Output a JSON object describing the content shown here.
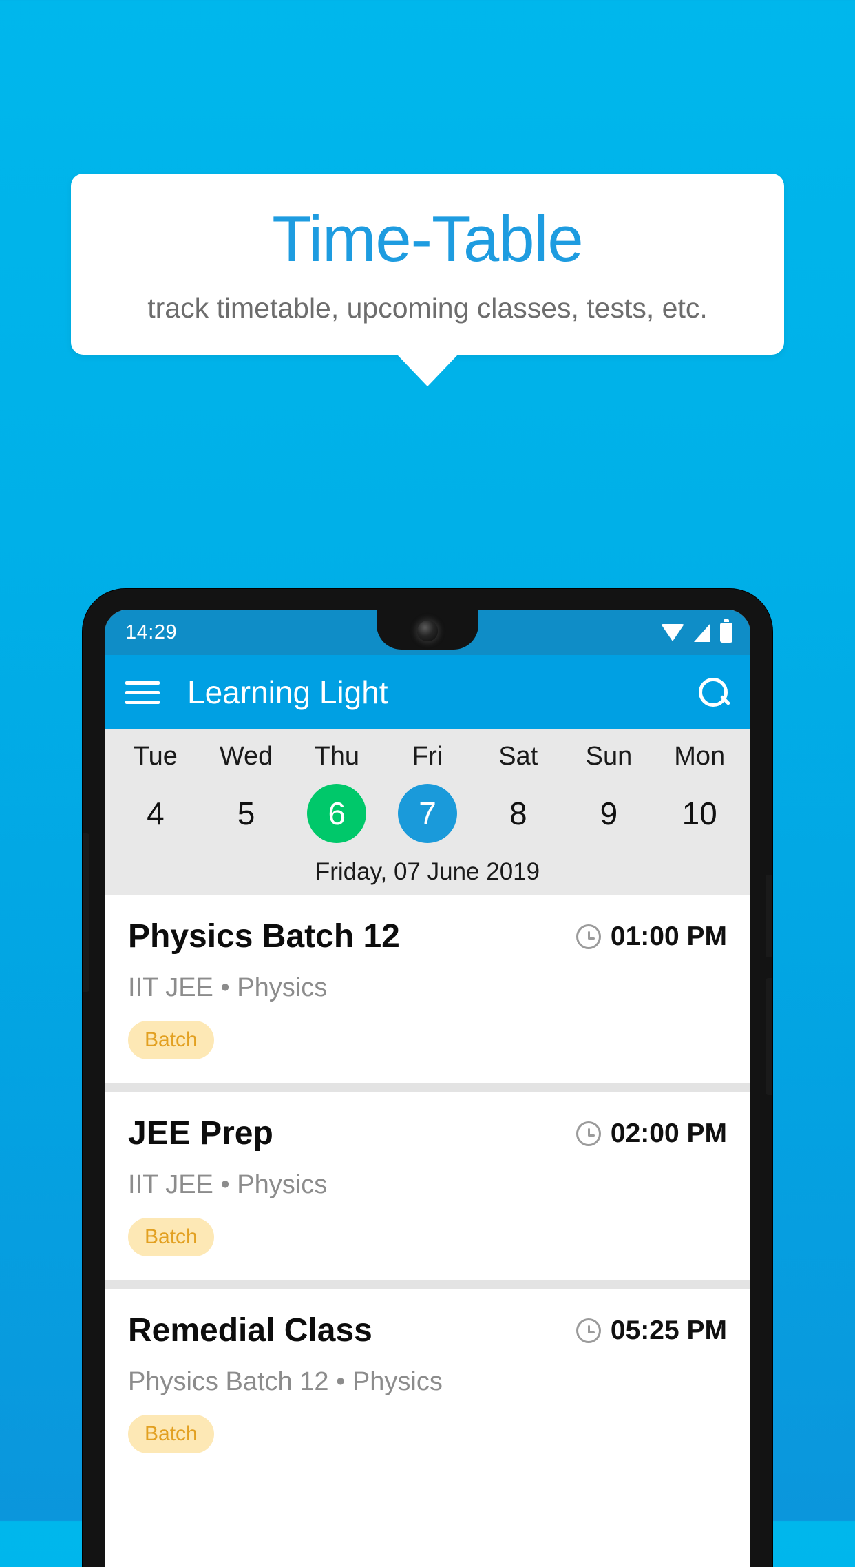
{
  "promo": {
    "title": "Time-Table",
    "subtitle": "track timetable, upcoming classes, tests, etc.",
    "title_color": "#1e9ce0",
    "background_color": "#00b0e8"
  },
  "phone": {
    "statusbar": {
      "time": "14:29",
      "icons": [
        "wifi-icon",
        "signal-icon",
        "battery-icon"
      ]
    },
    "appbar": {
      "menu_icon": "hamburger-menu-icon",
      "title": "Learning Light",
      "search_icon": "search-icon",
      "background_color": "#00a0e3"
    },
    "week_strip": {
      "days": [
        {
          "name": "Tue",
          "num": "4",
          "state": "normal"
        },
        {
          "name": "Wed",
          "num": "5",
          "state": "normal"
        },
        {
          "name": "Thu",
          "num": "6",
          "state": "green"
        },
        {
          "name": "Fri",
          "num": "7",
          "state": "blue"
        },
        {
          "name": "Sat",
          "num": "8",
          "state": "normal"
        },
        {
          "name": "Sun",
          "num": "9",
          "state": "normal"
        },
        {
          "name": "Mon",
          "num": "10",
          "state": "normal"
        }
      ],
      "selected_date_label": "Friday, 07 June 2019",
      "today_color": "#00c86a",
      "selected_color": "#1a9ada"
    },
    "events": [
      {
        "title": "Physics Batch 12",
        "time": "01:00 PM",
        "subtitle": "IIT JEE • Physics",
        "tag": "Batch"
      },
      {
        "title": "JEE Prep",
        "time": "02:00 PM",
        "subtitle": "IIT JEE • Physics",
        "tag": "Batch"
      },
      {
        "title": "Remedial Class",
        "time": "05:25 PM",
        "subtitle": "Physics Batch 12 • Physics",
        "tag": "Batch"
      }
    ]
  }
}
